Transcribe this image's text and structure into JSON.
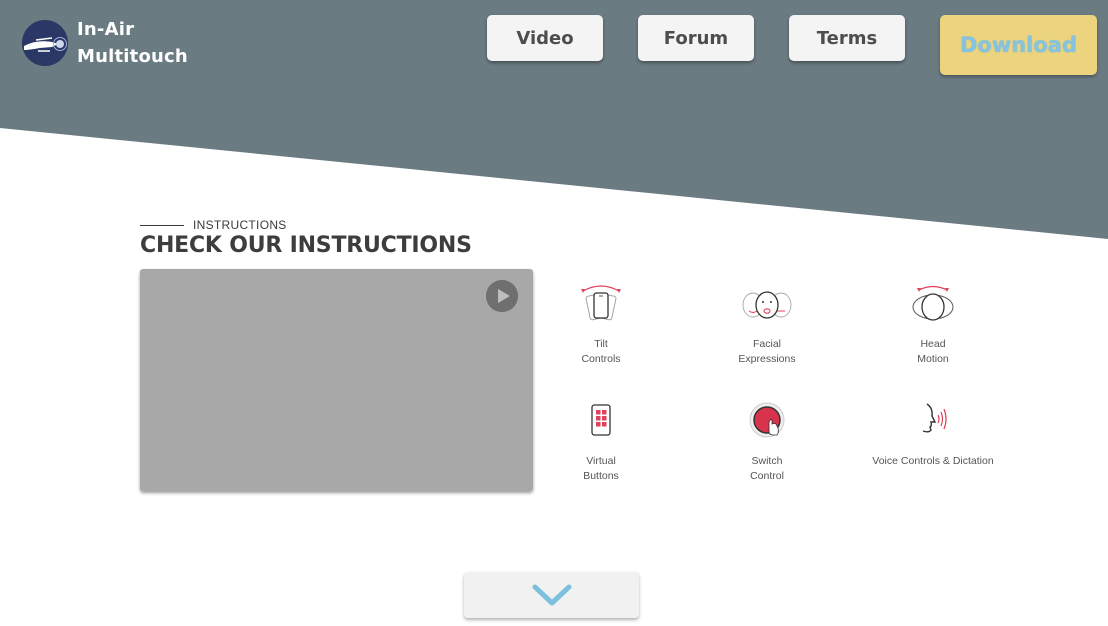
{
  "colors": {
    "hero": "#6b7b82",
    "accent_strip": "#3d8bf0",
    "download_bg": "#ecd47e",
    "download_text": "#87c3de",
    "icon_accent": "#e0405a",
    "chevron": "#7cc0dd"
  },
  "brand": {
    "line1": "In-Air",
    "line2": "Multitouch",
    "logo_icon": "hand-gesture-logo-icon"
  },
  "nav": {
    "video": "Video",
    "forum": "Forum",
    "terms": "Terms",
    "download": "Download"
  },
  "section": {
    "eyebrow": "INSTRUCTIONS",
    "title": "CHECK OUR INSTRUCTIONS"
  },
  "video": {
    "play_icon": "play-icon"
  },
  "features": [
    {
      "label": "Tilt\nControls",
      "icon": "tilt-phone-icon"
    },
    {
      "label": "Facial\nExpressions",
      "icon": "facial-expressions-icon"
    },
    {
      "label": "Head\nMotion",
      "icon": "head-motion-icon"
    },
    {
      "label": "Virtual\nButtons",
      "icon": "virtual-buttons-icon"
    },
    {
      "label": "Switch\nControl",
      "icon": "switch-control-icon"
    },
    {
      "label": "Voice Controls & Dictation",
      "icon": "voice-dictation-icon"
    }
  ],
  "scroll": {
    "icon": "chevron-down-icon"
  }
}
